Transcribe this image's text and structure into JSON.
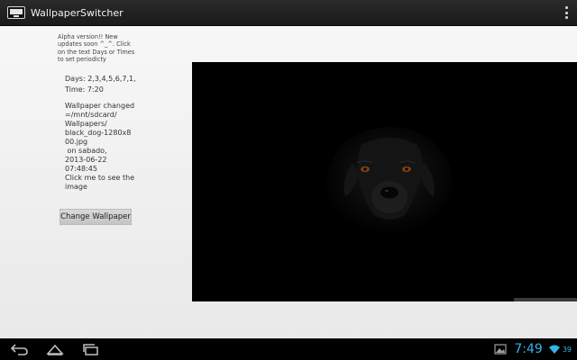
{
  "app": {
    "title": "WallpaperSwitcher"
  },
  "content": {
    "alpha_note": "Alpha version!! New updates soon ^_^. Click on the text Days or Times to set periodicty",
    "days": "Days: 2,3,4,5,6,7,1,",
    "time": "Time: 7:20",
    "wallpaper_info": [
      "Wallpaper changed",
      "=/mnt/sdcard/",
      "Wallpapers/",
      "black_dog-1280x8",
      "00.jpg",
      " on sabado,",
      "2013-06-22",
      "07:48:45",
      "Click me to see the",
      "image"
    ],
    "change_button": "Change Wallpaper"
  },
  "preview": {
    "subject_icon": "black-dog-wallpaper"
  },
  "system": {
    "clock": "7:49",
    "battery": "39",
    "accent_color": "#33b5e5"
  },
  "icons": {
    "back": "back-icon",
    "home": "home-icon",
    "recents": "recents-icon",
    "gallery": "gallery-notification-icon",
    "wifi": "wifi-icon",
    "overflow": "overflow-menu-icon"
  }
}
